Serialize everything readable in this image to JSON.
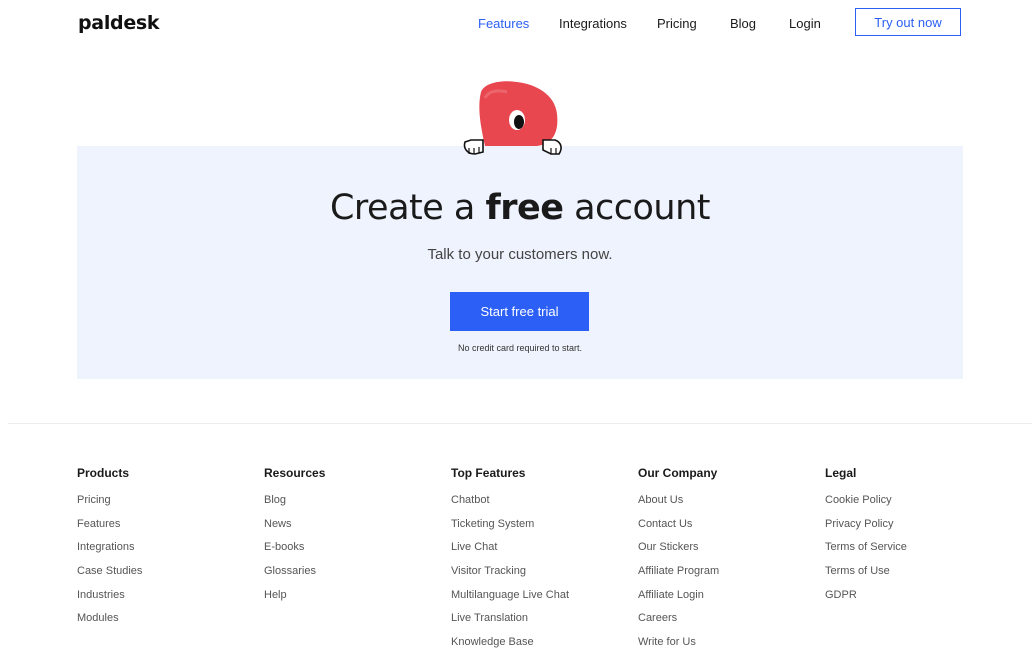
{
  "header": {
    "logo": "paldesk",
    "nav": [
      "Features",
      "Integrations",
      "Pricing",
      "Blog",
      "Login"
    ],
    "cta": "Try out now"
  },
  "hero": {
    "headline_pre": "Create a ",
    "headline_bold": "free",
    "headline_post": " account",
    "subline": "Talk to your customers now.",
    "button": "Start free trial",
    "note": "No credit card required to start."
  },
  "footer": {
    "columns": [
      {
        "title": "Products",
        "links": [
          "Pricing",
          "Features",
          "Integrations",
          "Case Studies",
          "Industries",
          "Modules"
        ]
      },
      {
        "title": "Resources",
        "links": [
          "Blog",
          "News",
          "E-books",
          "Glossaries",
          "Help"
        ]
      },
      {
        "title": "Top Features",
        "links": [
          "Chatbot",
          "Ticketing System",
          "Live Chat",
          "Visitor Tracking",
          "Multilanguage Live Chat",
          "Live Translation",
          "Knowledge Base"
        ]
      },
      {
        "title": "Our Company",
        "links": [
          "About Us",
          "Contact Us",
          "Our Stickers",
          "Affiliate Program",
          "Affiliate Login",
          "Careers",
          "Write for Us"
        ]
      },
      {
        "title": "Legal",
        "links": [
          "Cookie Policy",
          "Privacy Policy",
          "Terms of Service",
          "Terms of Use",
          "GDPR"
        ]
      }
    ]
  },
  "colors": {
    "accent": "#2b5ff5",
    "hero_bg": "#eef3fd",
    "mascot": "#e8474f"
  },
  "icons": {
    "mascot": "paldesk-mascot-icon"
  }
}
